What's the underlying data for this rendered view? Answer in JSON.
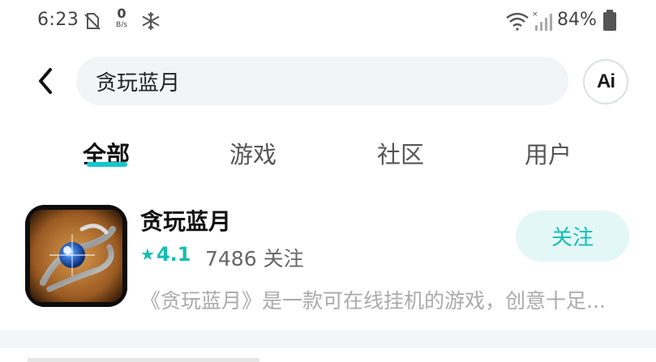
{
  "status_bar": {
    "time": "6:23",
    "net_speed_value": "0",
    "net_speed_unit": "B/s",
    "battery_percent": "84%",
    "icons": [
      "no-sim-icon",
      "snowflake-icon",
      "wifi-icon",
      "signal-icon",
      "battery-icon"
    ]
  },
  "search": {
    "value": "贪玩蓝月",
    "ai_label": "Ai"
  },
  "tabs": [
    {
      "label": "全部",
      "active": true
    },
    {
      "label": "游戏",
      "active": false
    },
    {
      "label": "社区",
      "active": false
    },
    {
      "label": "用户",
      "active": false
    }
  ],
  "results": [
    {
      "name": "贪玩蓝月",
      "rating": "4.1",
      "followers": "7486 关注",
      "description": "《贪玩蓝月》是一款可在线挂机的游戏，创意十足...",
      "follow_label": "关注"
    }
  ],
  "colors": {
    "accent": "#15c5ce",
    "rating": "#15bdb1",
    "follow_bg": "#e3f7f6"
  }
}
